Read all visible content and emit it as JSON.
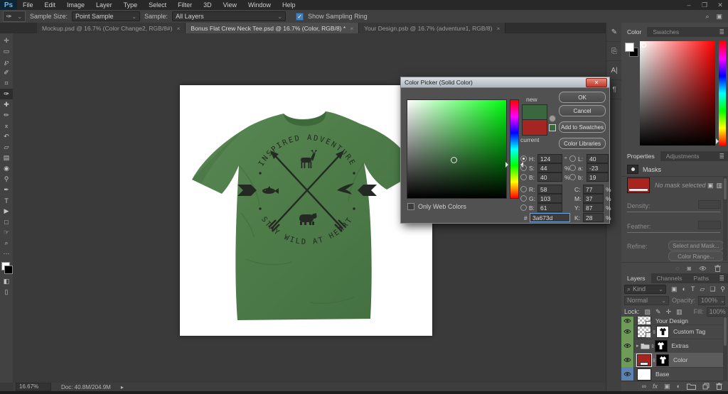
{
  "menubar": {
    "logo": "Ps",
    "items": [
      "File",
      "Edit",
      "Image",
      "Layer",
      "Type",
      "Select",
      "Filter",
      "3D",
      "View",
      "Window",
      "Help"
    ]
  },
  "window_controls": {
    "minimize": "–",
    "restore": "❐",
    "close": "✕"
  },
  "options_bar": {
    "sample_size_label": "Sample Size:",
    "sample_size_value": "Point Sample",
    "sample_label": "Sample:",
    "sample_value": "All Layers",
    "show_sampling_ring_label": "Show Sampling Ring",
    "checked_glyph": "✓"
  },
  "icons": {
    "eyedropper": "✑",
    "caret": "⌄",
    "search": "⌕",
    "workspace": "▣",
    "menu": "≣",
    "tab_close": "×",
    "collapse": "≪",
    "group_caret": "▸",
    "link": "∞",
    "fx": "fx",
    "mask": "▣",
    "adjustment": "◐",
    "type": "T",
    "shape": "▱",
    "smart": "❏",
    "pin": "⚲",
    "lock_checker": "▨",
    "lock_brush": "✎",
    "lock_move": "✛",
    "lock_board": "▥",
    "prop_select": "◌",
    "prop_apply": "◙",
    "chevron": "▸"
  },
  "tools": [
    {
      "name": "move-tool",
      "glyph": "✛"
    },
    {
      "name": "marquee-tool",
      "glyph": "▭"
    },
    {
      "name": "lasso-tool",
      "glyph": "℘"
    },
    {
      "name": "quick-selection-tool",
      "glyph": "✐"
    },
    {
      "name": "crop-tool",
      "glyph": "⌗"
    },
    {
      "name": "eyedropper-tool",
      "glyph": "✑"
    },
    {
      "name": "healing-brush-tool",
      "glyph": "✚"
    },
    {
      "name": "brush-tool",
      "glyph": "✏"
    },
    {
      "name": "clone-stamp-tool",
      "glyph": "⌅"
    },
    {
      "name": "history-brush-tool",
      "glyph": "↶"
    },
    {
      "name": "eraser-tool",
      "glyph": "▱"
    },
    {
      "name": "gradient-tool",
      "glyph": "▤"
    },
    {
      "name": "blur-tool",
      "glyph": "◉"
    },
    {
      "name": "dodge-tool",
      "glyph": "⚲"
    },
    {
      "name": "pen-tool",
      "glyph": "✒"
    },
    {
      "name": "type-tool",
      "glyph": "T"
    },
    {
      "name": "path-selection-tool",
      "glyph": "▶"
    },
    {
      "name": "rectangle-tool",
      "glyph": "□"
    },
    {
      "name": "hand-tool",
      "glyph": "☞"
    },
    {
      "name": "zoom-tool",
      "glyph": "⌕"
    },
    {
      "name": "edit-toolbar",
      "glyph": "⋯"
    },
    {
      "name": "quick-mask",
      "glyph": "◧"
    },
    {
      "name": "screen-mode",
      "glyph": "▯"
    }
  ],
  "tab_bar": {
    "tabs": [
      {
        "title": "Mockup.psd @ 16.7% (Color Change2, RGB/8#)"
      },
      {
        "title": "Bonus Flat Crew Neck Tee.psd @ 16.7% (Color, RGB/8) *"
      },
      {
        "title": "Your Design.psb @ 16.7% (adventure1, RGB/8)"
      }
    ]
  },
  "artboard": {
    "design_top": "INSPIRED ADVENTURE",
    "design_bottom": "STAY WILD AT HEART",
    "shirt_color": "#4e7c49",
    "print_color": "#242a23"
  },
  "color_picker": {
    "title": "Color Picker (Solid Color)",
    "new_label": "new",
    "current_label": "current",
    "new_color": "#3a673d",
    "current_color": "#a32623",
    "ok": "OK",
    "cancel": "Cancel",
    "add_to_swatches": "Add to Swatches",
    "color_libraries": "Color Libraries",
    "only_web_colors": "Only Web Colors",
    "hex_label": "#",
    "hex_value": "3a673d",
    "fields_left": [
      {
        "label": "H:",
        "value": "124",
        "unit": "°"
      },
      {
        "label": "S:",
        "value": "44",
        "unit": "%"
      },
      {
        "label": "B:",
        "value": "40",
        "unit": "%"
      },
      {
        "label": "R:",
        "value": "58",
        "unit": ""
      },
      {
        "label": "G:",
        "value": "103",
        "unit": ""
      },
      {
        "label": "B:",
        "value": "61",
        "unit": ""
      }
    ],
    "fields_right": [
      {
        "label": "L:",
        "value": "40",
        "unit": ""
      },
      {
        "label": "a:",
        "value": "-23",
        "unit": ""
      },
      {
        "label": "b:",
        "value": "19",
        "unit": ""
      },
      {
        "label": "C:",
        "value": "77",
        "unit": "%"
      },
      {
        "label": "M:",
        "value": "37",
        "unit": "%"
      },
      {
        "label": "Y:",
        "value": "87",
        "unit": "%"
      },
      {
        "label": "K:",
        "value": "28",
        "unit": "%"
      }
    ]
  },
  "color_panel": {
    "tab_color": "Color",
    "tab_swatches": "Swatches"
  },
  "properties_panel": {
    "tab_properties": "Properties",
    "tab_adjustments": "Adjustments",
    "masks_label": "Masks",
    "no_mask": "No mask selected",
    "density_label": "Density:",
    "feather_label": "Feather:",
    "refine_label": "Refine:",
    "select_and_mask": "Select and Mask...",
    "color_range": "Color Range..."
  },
  "layers_panel": {
    "tab_layers": "Layers",
    "tab_channels": "Channels",
    "tab_paths": "Paths",
    "kind": "Kind",
    "blend_mode": "Normal",
    "opacity_label": "Opacity:",
    "opacity_value": "100%",
    "lock_label": "Lock:",
    "fill_label": "Fill:",
    "fill_value": "100%",
    "layers": [
      {
        "name": "Your Design"
      },
      {
        "name": "Custom Tag"
      },
      {
        "name": "Extras"
      },
      {
        "name": "Color"
      },
      {
        "name": "Base"
      }
    ]
  },
  "status_bar": {
    "zoom": "16.67%",
    "doc": "Doc: 40.8M/204.9M"
  },
  "dock_strip": {
    "char_icon": "A|",
    "paragraph_icon": "¶",
    "brush_icon": "✎",
    "clone_icon": "⎘"
  }
}
